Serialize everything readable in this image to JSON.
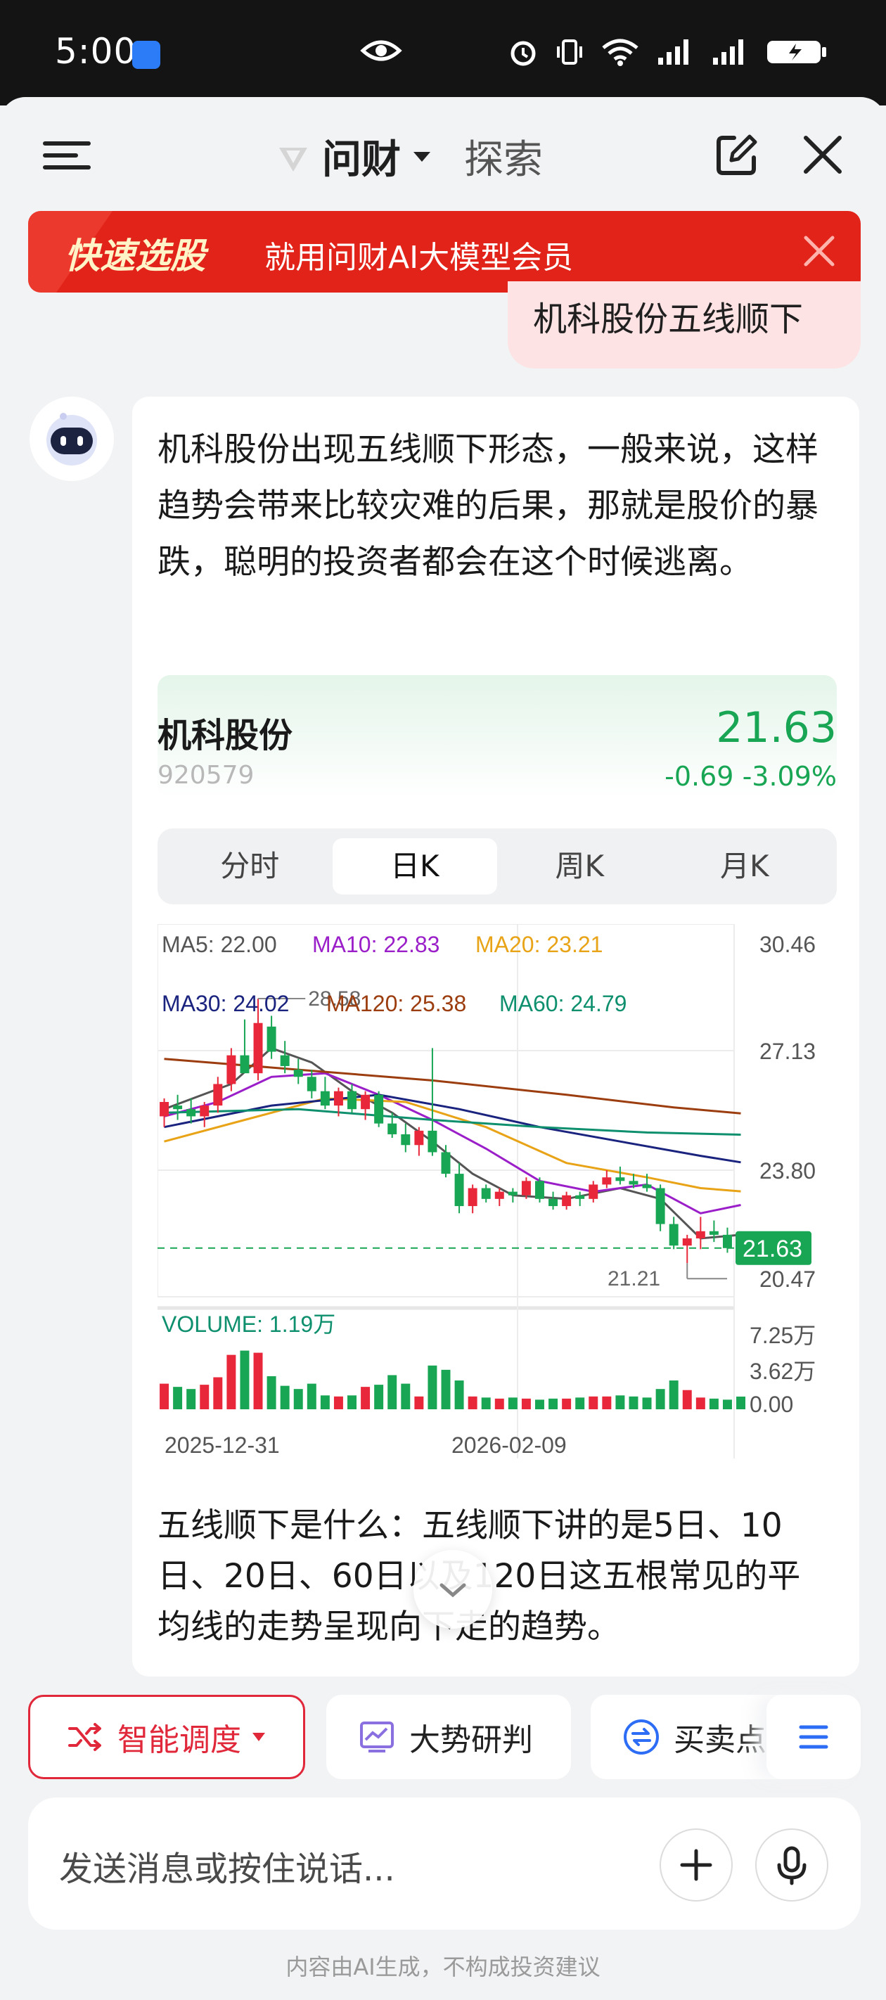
{
  "status_bar": {
    "time": "5:00"
  },
  "nav": {
    "title": "问财",
    "search": "探索"
  },
  "promo": {
    "tag": "快速选股",
    "text": "就用问财AI大模型会员"
  },
  "user_message": "机科股份五线顺下",
  "answer": {
    "paragraph1": "机科股份出现五线顺下形态，一般来说，这样趋势会带来比较灾难的后果，那就是股价的暴跌，聪明的投资者都会在这个时候逃离。",
    "paragraph2": "五线顺下是什么：五线顺下讲的是5日、10日、20日、60日以及120日这五根常见的平均线的走势呈现向下走的趋势。"
  },
  "stock": {
    "name": "机科股份",
    "code": "920579",
    "price": "21.63",
    "change": "-0.69",
    "change_pct": "-3.09%",
    "color_down": "#19a654",
    "color_up": "#e8283a"
  },
  "tabs": [
    {
      "label": "分时",
      "active": false
    },
    {
      "label": "日K",
      "active": true
    },
    {
      "label": "周K",
      "active": false
    },
    {
      "label": "月K",
      "active": false
    }
  ],
  "chart_data": {
    "type": "candlestick",
    "price_axis_ticks": [
      "30.46",
      "27.13",
      "23.80",
      "20.47"
    ],
    "volume_axis_ticks": [
      "7.25万",
      "3.62万",
      "0.00"
    ],
    "x_labels": [
      "2025-12-31",
      "2026-02-09"
    ],
    "ma_legend": [
      {
        "name": "MA5",
        "value": "MA5: 22.00",
        "color": "#555555"
      },
      {
        "name": "MA10",
        "value": "MA10: 22.83",
        "color": "#9b1fc9"
      },
      {
        "name": "MA20",
        "value": "MA20: 23.21",
        "color": "#e8a317"
      },
      {
        "name": "MA30",
        "value": "MA30: 24.02",
        "color": "#1a237e"
      },
      {
        "name": "MA120",
        "value": "MA120: 25.38",
        "color": "#9c3d0f"
      },
      {
        "name": "MA60",
        "value": "MA60: 24.79",
        "color": "#0e8f6e"
      }
    ],
    "high_label": "28.58",
    "low_label": "21.21",
    "last_label": "21.63",
    "volume_label": "VOLUME: 1.19万",
    "candles": [
      [
        25.3,
        25.8,
        25.0,
        25.7
      ],
      [
        25.6,
        25.9,
        25.2,
        25.5
      ],
      [
        25.5,
        25.8,
        25.1,
        25.3
      ],
      [
        25.3,
        25.7,
        25.0,
        25.6
      ],
      [
        25.6,
        26.4,
        25.4,
        26.2
      ],
      [
        26.2,
        27.2,
        26.0,
        27.0
      ],
      [
        27.0,
        28.0,
        26.6,
        26.5
      ],
      [
        26.5,
        28.58,
        26.3,
        27.9
      ],
      [
        27.8,
        28.1,
        26.9,
        27.1
      ],
      [
        27.0,
        27.4,
        26.5,
        26.7
      ],
      [
        26.6,
        26.9,
        26.2,
        26.4
      ],
      [
        26.4,
        26.6,
        25.8,
        26.0
      ],
      [
        26.0,
        26.4,
        25.5,
        25.6
      ],
      [
        25.6,
        26.1,
        25.3,
        26.0
      ],
      [
        26.0,
        26.2,
        25.4,
        25.5
      ],
      [
        25.5,
        26.0,
        25.2,
        25.9
      ],
      [
        25.9,
        26.0,
        25.0,
        25.1
      ],
      [
        25.1,
        25.4,
        24.7,
        24.8
      ],
      [
        24.8,
        25.1,
        24.3,
        24.5
      ],
      [
        24.5,
        25.0,
        24.2,
        24.9
      ],
      [
        24.9,
        27.2,
        24.2,
        24.3
      ],
      [
        24.3,
        24.5,
        23.6,
        23.7
      ],
      [
        23.7,
        24.0,
        22.6,
        22.8
      ],
      [
        22.8,
        23.4,
        22.6,
        23.3
      ],
      [
        23.3,
        23.4,
        22.9,
        23.0
      ],
      [
        23.0,
        23.3,
        22.8,
        23.2
      ],
      [
        23.2,
        23.3,
        22.9,
        23.1
      ],
      [
        23.1,
        23.6,
        23.0,
        23.5
      ],
      [
        23.5,
        23.6,
        22.9,
        23.0
      ],
      [
        23.0,
        23.2,
        22.7,
        22.8
      ],
      [
        22.8,
        23.2,
        22.7,
        23.1
      ],
      [
        23.1,
        23.2,
        22.8,
        23.0
      ],
      [
        23.0,
        23.5,
        22.9,
        23.4
      ],
      [
        23.4,
        23.8,
        23.3,
        23.6
      ],
      [
        23.6,
        23.9,
        23.4,
        23.5
      ],
      [
        23.5,
        23.7,
        23.3,
        23.4
      ],
      [
        23.4,
        23.7,
        23.2,
        23.3
      ],
      [
        23.3,
        23.4,
        22.1,
        22.3
      ],
      [
        22.3,
        22.5,
        21.6,
        21.7
      ],
      [
        21.7,
        22.0,
        21.21,
        21.9
      ],
      [
        21.9,
        22.5,
        21.6,
        22.1
      ],
      [
        22.1,
        22.4,
        21.8,
        22.0
      ],
      [
        22.0,
        22.2,
        21.5,
        21.63
      ]
    ],
    "volumes": [
      2.4,
      2.1,
      1.9,
      2.3,
      3.0,
      5.1,
      5.5,
      5.3,
      3.1,
      2.2,
      1.9,
      2.4,
      1.3,
      1.2,
      1.3,
      2.1,
      2.3,
      3.2,
      2.4,
      1.2,
      4.1,
      3.7,
      2.7,
      1.2,
      1.1,
      1.0,
      1.1,
      1.0,
      0.9,
      1.0,
      1.0,
      1.1,
      1.2,
      1.2,
      1.3,
      1.2,
      1.1,
      1.9,
      2.7,
      1.8,
      1.1,
      1.0,
      0.9,
      1.19
    ],
    "ma": {
      "MA5": [
        [
          0,
          25.5
        ],
        [
          5,
          26.2
        ],
        [
          8,
          27.2
        ],
        [
          11,
          26.8
        ],
        [
          14,
          26.0
        ],
        [
          17,
          25.4
        ],
        [
          20,
          24.6
        ],
        [
          23,
          23.7
        ],
        [
          26,
          23.1
        ],
        [
          30,
          23.0
        ],
        [
          34,
          23.3
        ],
        [
          37,
          23.0
        ],
        [
          40,
          21.9
        ],
        [
          43,
          22.0
        ]
      ],
      "MA10": [
        [
          0,
          25.3
        ],
        [
          4,
          25.7
        ],
        [
          8,
          26.4
        ],
        [
          12,
          26.5
        ],
        [
          16,
          25.9
        ],
        [
          20,
          25.2
        ],
        [
          24,
          24.4
        ],
        [
          28,
          23.5
        ],
        [
          32,
          23.2
        ],
        [
          36,
          23.4
        ],
        [
          40,
          22.6
        ],
        [
          43,
          22.83
        ]
      ],
      "MA20": [
        [
          0,
          24.6
        ],
        [
          6,
          25.2
        ],
        [
          12,
          25.8
        ],
        [
          18,
          25.7
        ],
        [
          24,
          25.0
        ],
        [
          30,
          24.0
        ],
        [
          36,
          23.6
        ],
        [
          40,
          23.3
        ],
        [
          43,
          23.21
        ]
      ],
      "MA30": [
        [
          0,
          25.0
        ],
        [
          8,
          25.6
        ],
        [
          16,
          25.9
        ],
        [
          22,
          25.5
        ],
        [
          28,
          25.0
        ],
        [
          34,
          24.6
        ],
        [
          40,
          24.2
        ],
        [
          43,
          24.02
        ]
      ],
      "MA60": [
        [
          0,
          25.4
        ],
        [
          10,
          25.5
        ],
        [
          20,
          25.2
        ],
        [
          28,
          25.0
        ],
        [
          36,
          24.85
        ],
        [
          43,
          24.79
        ]
      ],
      "MA120": [
        [
          0,
          26.9
        ],
        [
          10,
          26.6
        ],
        [
          20,
          26.3
        ],
        [
          30,
          25.9
        ],
        [
          38,
          25.55
        ],
        [
          43,
          25.38
        ]
      ]
    },
    "price_range": [
      20.47,
      30.46
    ],
    "volume_range": [
      0,
      7.25
    ]
  },
  "quick_actions": [
    {
      "label": "智能调度",
      "icon": "shuffle-icon"
    },
    {
      "label": "大势研判",
      "icon": "trend-chart-icon"
    },
    {
      "label": "买卖点",
      "icon": "exchange-icon"
    }
  ],
  "input": {
    "placeholder": "发送消息或按住说话..."
  },
  "disclaimer": "内容由AI生成，不构成投资建议"
}
